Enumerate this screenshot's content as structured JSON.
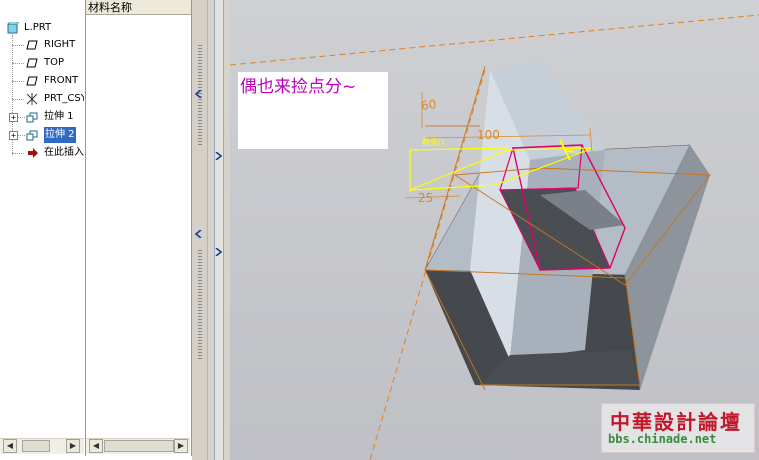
{
  "model_tree": {
    "items": [
      {
        "label": "L.PRT",
        "icon": "part-icon"
      },
      {
        "label": "RIGHT",
        "icon": "datum-plane-icon"
      },
      {
        "label": "TOP",
        "icon": "datum-plane-icon"
      },
      {
        "label": "FRONT",
        "icon": "datum-plane-icon"
      },
      {
        "label": "PRT_CSYS_DEF",
        "icon": "coordinate-system-icon"
      },
      {
        "label": "拉伸 1",
        "icon": "extrude-icon"
      },
      {
        "label": "拉伸 2",
        "icon": "extrude-icon",
        "selected": true
      },
      {
        "label": "在此插入",
        "icon": "insert-here-arrow-icon"
      }
    ]
  },
  "column_header": "材料名称",
  "note": "偶也来捡点分~",
  "dimensions": {
    "height": "60",
    "width": "100",
    "offset": "25",
    "section_label": "截面()"
  },
  "watermark": {
    "title": "中華設計論壇",
    "url": "bbs.chinade.net"
  },
  "colors": {
    "selection": "#316ac5",
    "note_text": "#c000c0",
    "sketch_highlight": "#e0006a",
    "sketch_plane": "#ffff00",
    "dimension": "#d98a2a"
  }
}
